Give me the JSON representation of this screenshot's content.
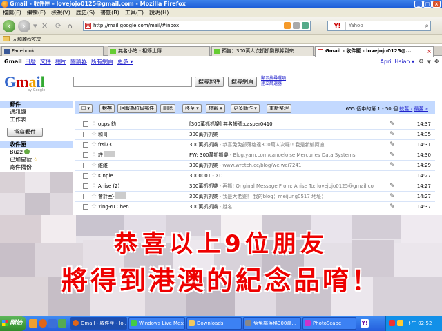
{
  "window": {
    "title": "Gmail - 收件匣 - lovejojo0125@gmail.com - Mozilla Firefox"
  },
  "menu": [
    "檔案(F)",
    "編輯(E)",
    "檢視(V)",
    "歷史(S)",
    "書籤(B)",
    "工具(T)",
    "說明(H)"
  ],
  "nav": {
    "url": "http://mail.google.com/mail/#inbox",
    "search_placeholder": "Yahoo"
  },
  "bookmarks": {
    "item": "元和麗秋吃文"
  },
  "tabs": [
    {
      "label": "Facebook",
      "active": false
    },
    {
      "label": "無名小站 - 相簿上傳",
      "active": false
    },
    {
      "label": "預告：300萬人次抓抓樂即將到來",
      "active": false
    },
    {
      "label": "Gmail - 收件匣 - lovejojo0125@...",
      "active": true
    }
  ],
  "gmail_top": {
    "brand": "Gmail",
    "links": [
      "日曆",
      "文件",
      "相片",
      "閱讀器",
      "所有網頁",
      "更多 ▾"
    ],
    "user": "April Hsiao ▾"
  },
  "logo": {
    "by": "by Google"
  },
  "search": {
    "mail_button": "搜尋郵件",
    "web_button": "搜尋網頁",
    "opt1": "顯示搜尋選項",
    "opt2": "建立篩選器"
  },
  "sidebar": {
    "mail_header": "郵件",
    "top_items": [
      "通訊錄",
      "工作表"
    ],
    "compose": "撰寫郵件",
    "inbox": "收件匣",
    "buzz": "Buzz",
    "starred": "已加星號",
    "sent": "寄件備份",
    "drafts": "草稿"
  },
  "toolbar": {
    "archive": "封存",
    "spam": "回報為垃圾郵件",
    "delete": "刪除",
    "move": "移至 ▾",
    "labels": "標籤 ▾",
    "more": "更多動作 ▾",
    "refresh": "重新整理",
    "page_count": "655 個中的第 1 - 50 個",
    "older": "較舊 ›",
    "oldest": "最舊 »"
  },
  "emails": [
    {
      "sender": "opps 鈞",
      "subject": "[300萬抓抓樂] 無名帳號:casper0410",
      "snippet": "",
      "time": "14:37"
    },
    {
      "sender": "和哥",
      "subject": "300萬抓抓樂",
      "snippet": "",
      "time": "14:35"
    },
    {
      "sender": "frsi73",
      "subject": "300萬抓抓樂",
      "snippet": " - 恭喜兔兔部落格達300萬人次囉!! 我是新編阿迪",
      "time": "14:31"
    },
    {
      "sender": "許",
      "subject": "FW: 300萬抓抓樂",
      "snippet": " - Blog.yam.com/canoeloise Mercuries Data Systems",
      "time": "14:30"
    },
    {
      "sender": "維維",
      "subject": "300萬抓抓樂",
      "snippet": " - www.wretch.cc/blog/weiwei7241",
      "time": "14:29"
    },
    {
      "sender": "Kinple",
      "subject": "3000001",
      "snippet": " - XD",
      "time": "14:27"
    },
    {
      "sender": "Anise (2)",
      "subject": "300萬抓抓樂",
      "snippet": " - 再抓! Original Message From: Anise To: lovejojo0125@gmail.co",
      "time": "14:27"
    },
    {
      "sender": "會計室-",
      "subject": "300萬抓抓樂",
      "snippet": " - 我是大老婆！ 我的blog：meijung0517 地址：",
      "time": "14:27"
    },
    {
      "sender": "Ying-Yu Chen",
      "subject": "300萬抓抓樂",
      "snippet": " - 姓名",
      "time": "14:37"
    }
  ],
  "overlay": {
    "line1": "恭喜以上9位朋友",
    "line2": "將得到港澳的紀念品唷！"
  },
  "taskbar": {
    "start": "開始",
    "items": [
      {
        "label": "Gmail - 收件匣 - lo...",
        "active": true
      },
      {
        "label": "Windows Live Mess...",
        "active": false
      },
      {
        "label": "Downloads",
        "active": false
      },
      {
        "label": "兔兔部落格300萬...",
        "active": false
      },
      {
        "label": "PhotoScape",
        "active": false
      }
    ],
    "clock": "下午 02:52"
  },
  "colors": {
    "titlebar": "#1b5bd6",
    "gmail_blue": "#c3d9ff",
    "overlay_red": "#e00000",
    "taskbar": "#245edc"
  }
}
